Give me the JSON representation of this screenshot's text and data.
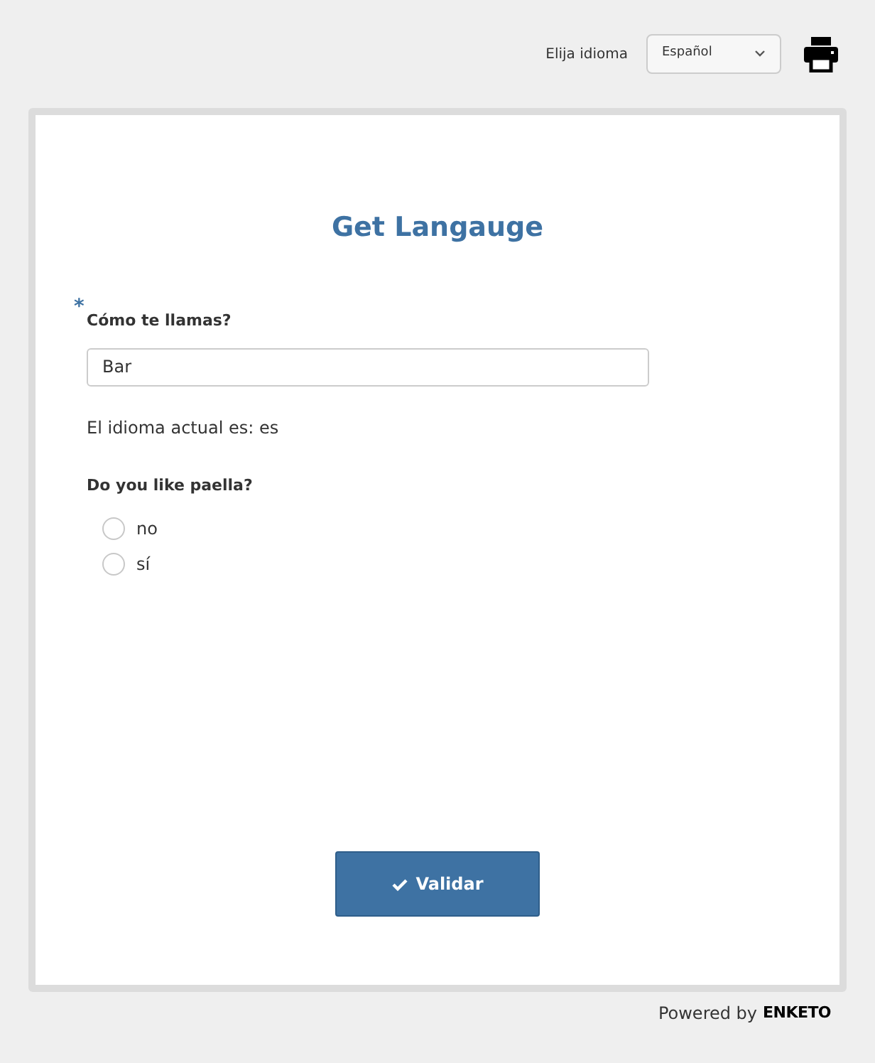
{
  "language_selector": {
    "label": "Elija idioma",
    "value": "Español"
  },
  "form": {
    "title": "Get Langauge",
    "questions": [
      {
        "kind": "text",
        "label": "Cómo te llamas?",
        "required_mark": "*",
        "value": "Bar"
      },
      {
        "kind": "note",
        "text": "El idioma actual es: es"
      },
      {
        "kind": "radio",
        "label": "Do you like paella?",
        "options": [
          {
            "label": "no",
            "selected": false
          },
          {
            "label": "sí",
            "selected": false
          }
        ]
      }
    ]
  },
  "submit_button": {
    "label": "Validar"
  },
  "footer": {
    "text": "Powered by",
    "brand": "ENKETO"
  }
}
